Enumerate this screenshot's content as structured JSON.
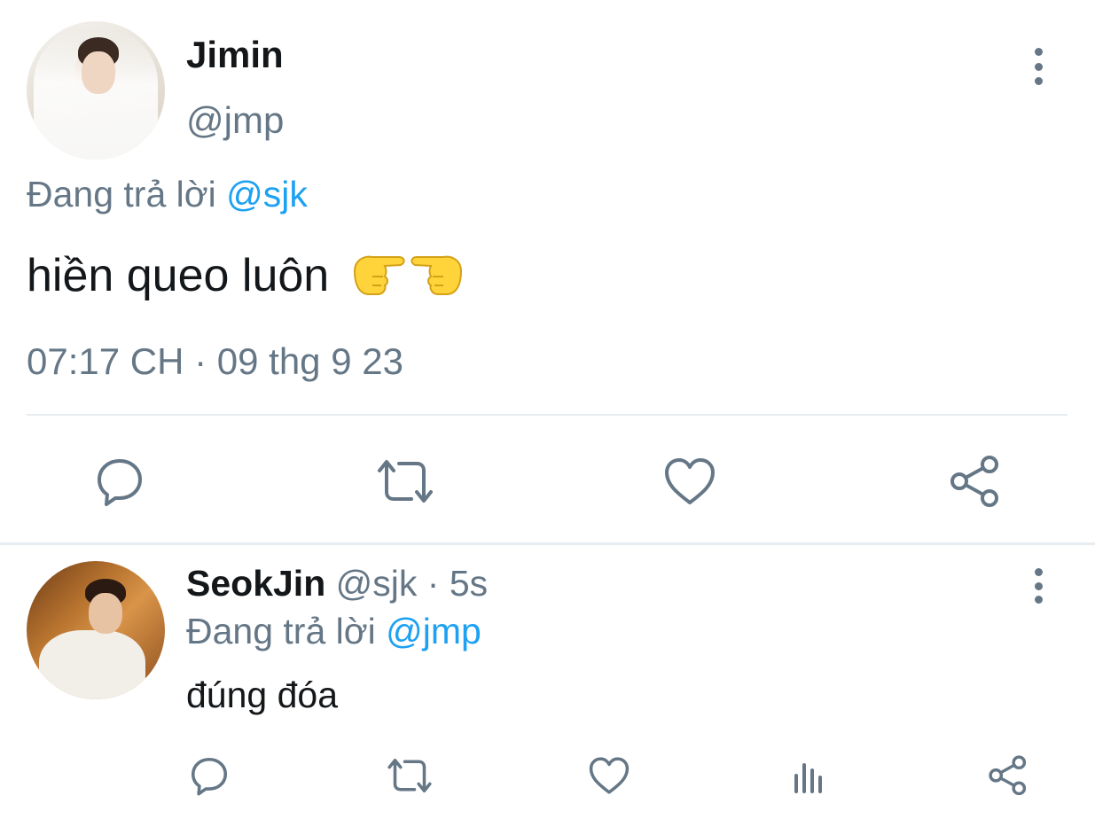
{
  "main_tweet": {
    "name": "Jimin",
    "handle": "@jmp",
    "reply_prefix": "Đang trả lời ",
    "reply_mention": "@sjk",
    "text": "hiền queo luôn",
    "emoji_names": [
      "pointing-right-hand-icon",
      "pointing-left-hand-icon"
    ],
    "timestamp": "07:17 CH · 09 thg 9 23",
    "actions": [
      "reply-icon",
      "retweet-icon",
      "like-icon",
      "share-icon"
    ]
  },
  "reply_tweet": {
    "name": "SeokJin",
    "handle": "@sjk",
    "separator": " · ",
    "time": "5s",
    "reply_prefix": "Đang trả lời ",
    "reply_mention": "@jmp",
    "text": "đúng đóa",
    "actions": [
      "reply-icon",
      "retweet-icon",
      "like-icon",
      "analytics-icon",
      "share-icon"
    ]
  },
  "colors": {
    "primary_text": "#14171a",
    "secondary_text": "#657786",
    "link": "#1da1f2",
    "divider": "#e6ecf0",
    "emoji_yellow": "#ffd43b"
  }
}
